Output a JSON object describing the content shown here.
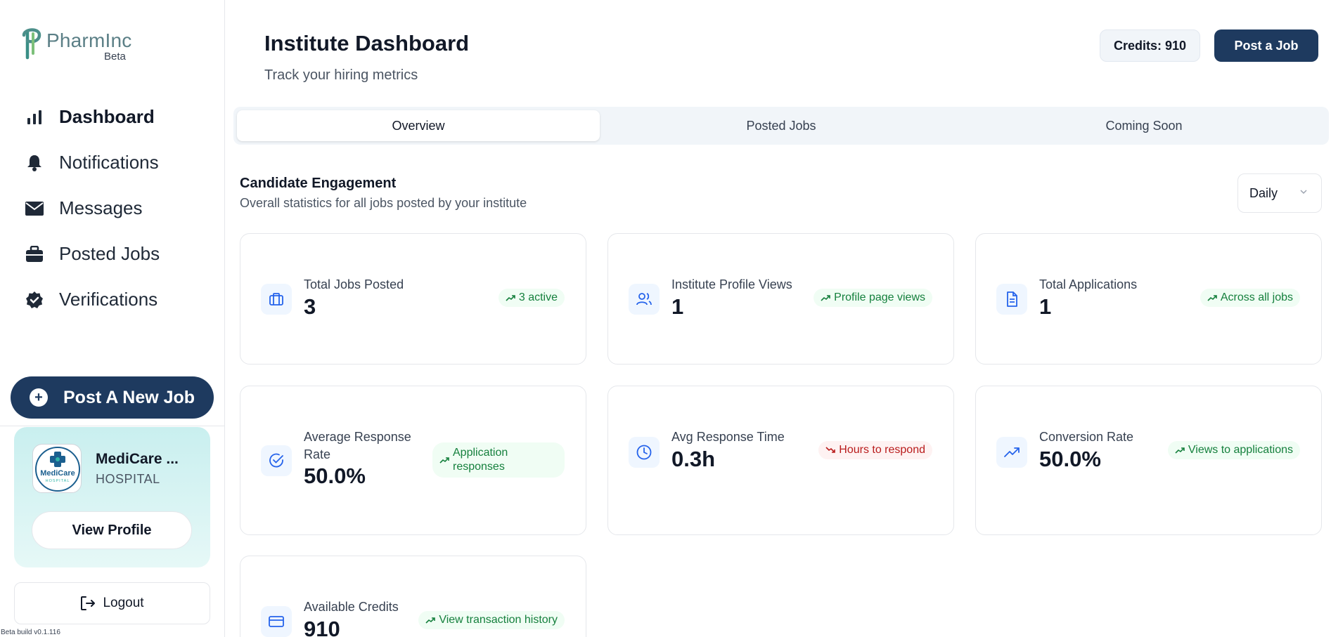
{
  "brand": {
    "name": "PharmInc",
    "tag": "Beta"
  },
  "sidebar": {
    "items": [
      {
        "label": "Dashboard",
        "icon": "bar-chart-icon",
        "active": true
      },
      {
        "label": "Notifications",
        "icon": "bell-icon"
      },
      {
        "label": "Messages",
        "icon": "mail-icon"
      },
      {
        "label": "Posted Jobs",
        "icon": "briefcase-icon"
      },
      {
        "label": "Verifications",
        "icon": "badge-check-icon"
      }
    ],
    "post_new_label": "Post A New Job",
    "profile": {
      "name": "MediCare ...",
      "type": "HOSPITAL",
      "view_label": "View Profile"
    },
    "logout_label": "Logout",
    "build": "Beta build v0.1.116"
  },
  "header": {
    "title": "Institute Dashboard",
    "subtitle": "Track your hiring metrics",
    "credits_label": "Credits: 910",
    "post_job_label": "Post a Job"
  },
  "tabs": [
    {
      "label": "Overview",
      "active": true
    },
    {
      "label": "Posted Jobs"
    },
    {
      "label": "Coming Soon"
    }
  ],
  "section": {
    "title": "Candidate Engagement",
    "subtitle": "Overall statistics for all jobs posted by your institute",
    "period": "Daily"
  },
  "stats": [
    {
      "title": "Total Jobs Posted",
      "value": "3",
      "badge": "3 active",
      "trend": "up",
      "icon": "briefcase-icon"
    },
    {
      "title": "Institute Profile Views",
      "value": "1",
      "badge": "Profile page views",
      "trend": "up",
      "icon": "users-icon"
    },
    {
      "title": "Total Applications",
      "value": "1",
      "badge": "Across all jobs",
      "trend": "up",
      "icon": "file-text-icon"
    },
    {
      "title": "Average Response Rate",
      "value": "50.0%",
      "badge": "Application responses",
      "trend": "up",
      "icon": "check-circle-icon"
    },
    {
      "title": "Avg Response Time",
      "value": "0.3h",
      "badge": "Hours to respond",
      "trend": "down",
      "icon": "clock-icon"
    },
    {
      "title": "Conversion Rate",
      "value": "50.0%",
      "badge": "Views to applications",
      "trend": "up",
      "icon": "trending-up-icon"
    },
    {
      "title": "Available Credits",
      "value": "910",
      "badge": "View transaction history",
      "trend": "up",
      "icon": "credit-card-icon"
    }
  ],
  "colors": {
    "primary": "#1e3a5f",
    "accent": "#2563eb",
    "positive": "#15803d",
    "negative": "#b91c1c"
  }
}
